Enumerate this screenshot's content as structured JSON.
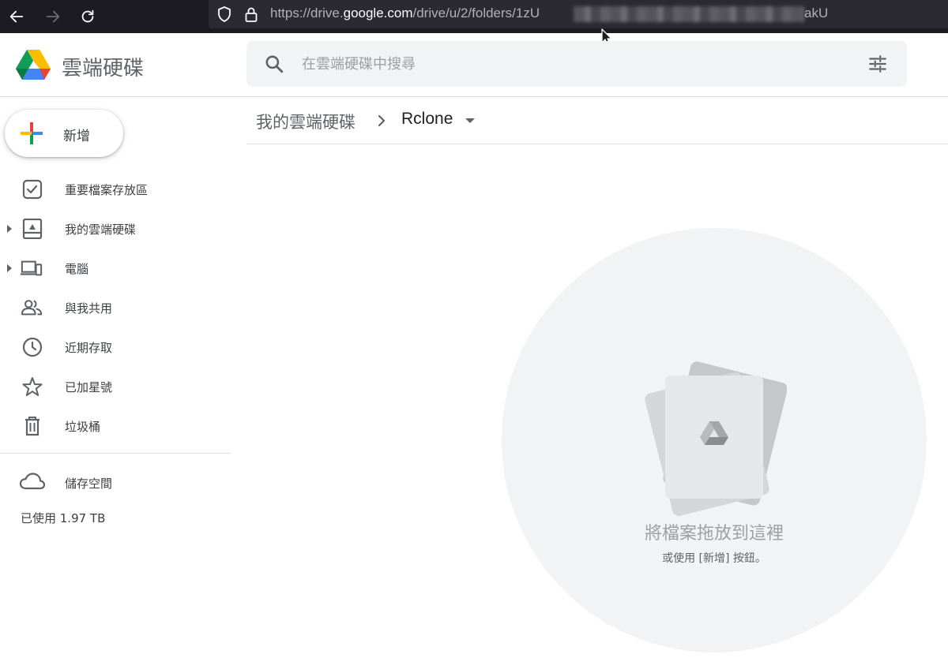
{
  "browser": {
    "url_prefix": "https://drive.",
    "url_domain": "google.com",
    "url_path": "/drive/u/2/folders/1zU",
    "url_suffix": "akU",
    "icons": [
      "back-arrow-icon",
      "forward-arrow-icon",
      "reload-icon",
      "shield-icon",
      "lock-icon"
    ]
  },
  "header": {
    "app_title": "雲端硬碟",
    "search_placeholder": "在雲端硬碟中搜尋"
  },
  "sidebar": {
    "new_label": "新增",
    "items": [
      {
        "label": "重要檔案存放區",
        "icon": "priority-check-icon"
      },
      {
        "label": "我的雲端硬碟",
        "icon": "my-drive-icon"
      },
      {
        "label": "電腦",
        "icon": "computers-icon"
      },
      {
        "label": "與我共用",
        "icon": "shared-people-icon"
      },
      {
        "label": "近期存取",
        "icon": "clock-icon"
      },
      {
        "label": "已加星號",
        "icon": "star-icon"
      },
      {
        "label": "垃圾桶",
        "icon": "trash-icon"
      }
    ],
    "storage_label": "儲存空間",
    "storage_used": "已使用 1.97 TB"
  },
  "breadcrumb": {
    "root": "我的雲端硬碟",
    "current": "Rclone"
  },
  "empty_state": {
    "title": "將檔案拖放到這裡",
    "subtitle": "或使用 [新增] 按鈕。"
  },
  "colors": {
    "browser_bg": "#1c1b22",
    "url_bar_bg": "#2b2a33",
    "search_bg": "#f1f3f4",
    "drive_blue": "#4285f4",
    "drive_green": "#0f9d58",
    "drive_yellow": "#fbbc04",
    "drive_red": "#ea4335"
  }
}
